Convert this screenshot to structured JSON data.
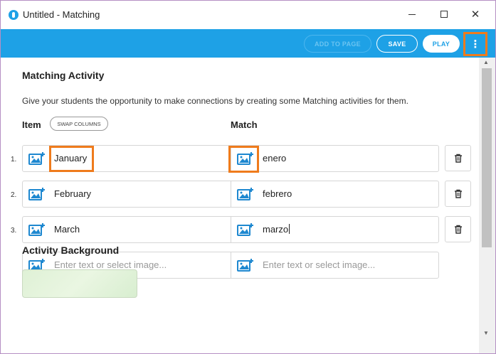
{
  "window": {
    "title": "Untitled - Matching",
    "minimize": "–",
    "close": "✕"
  },
  "toolbar": {
    "add_to_page": "ADD TO PAGE",
    "save": "SAVE",
    "play": "PLAY",
    "more": "⋮"
  },
  "activity": {
    "heading": "Matching Activity",
    "description": "Give your students the opportunity to make connections by creating some Matching activities for them.",
    "item_header": "Item",
    "swap_label": "SWAP COLUMNS",
    "match_header": "Match",
    "rows": [
      {
        "num": "1.",
        "item": "January",
        "match": "enero"
      },
      {
        "num": "2.",
        "item": "February",
        "match": "febrero"
      },
      {
        "num": "3.",
        "item": "March",
        "match": "marzo"
      }
    ],
    "placeholder": "Enter text or select image...",
    "background_heading": "Activity Background"
  },
  "colors": {
    "accent": "#1ea1e6",
    "highlight": "#ef7b1c"
  },
  "icons": [
    "add-image-icon",
    "trash-icon",
    "more-vertical-icon"
  ]
}
